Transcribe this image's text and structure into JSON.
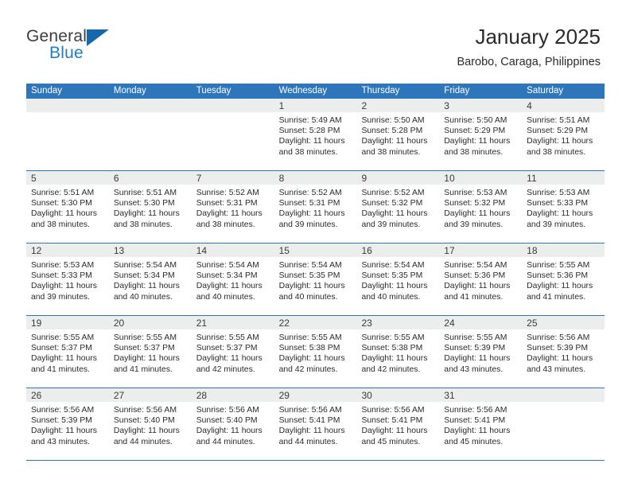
{
  "brand": {
    "name_part1": "General",
    "name_part2": "Blue",
    "accent_color": "#1668ad",
    "logo_icon": "triangle-flag-icon"
  },
  "header": {
    "title": "January 2025",
    "location": "Barobo, Caraga, Philippines"
  },
  "calendar": {
    "header_color": "#2e76bc",
    "daynum_band_color": "#eceded",
    "weekday_headers": [
      "Sunday",
      "Monday",
      "Tuesday",
      "Wednesday",
      "Thursday",
      "Friday",
      "Saturday"
    ],
    "weeks": [
      [
        {
          "day": "",
          "empty": true,
          "lines": []
        },
        {
          "day": "",
          "empty": true,
          "lines": []
        },
        {
          "day": "",
          "empty": true,
          "lines": []
        },
        {
          "day": "1",
          "empty": false,
          "lines": [
            "Sunrise: 5:49 AM",
            "Sunset: 5:28 PM",
            "Daylight: 11 hours",
            "and 38 minutes."
          ]
        },
        {
          "day": "2",
          "empty": false,
          "lines": [
            "Sunrise: 5:50 AM",
            "Sunset: 5:28 PM",
            "Daylight: 11 hours",
            "and 38 minutes."
          ]
        },
        {
          "day": "3",
          "empty": false,
          "lines": [
            "Sunrise: 5:50 AM",
            "Sunset: 5:29 PM",
            "Daylight: 11 hours",
            "and 38 minutes."
          ]
        },
        {
          "day": "4",
          "empty": false,
          "lines": [
            "Sunrise: 5:51 AM",
            "Sunset: 5:29 PM",
            "Daylight: 11 hours",
            "and 38 minutes."
          ]
        }
      ],
      [
        {
          "day": "5",
          "empty": false,
          "lines": [
            "Sunrise: 5:51 AM",
            "Sunset: 5:30 PM",
            "Daylight: 11 hours",
            "and 38 minutes."
          ]
        },
        {
          "day": "6",
          "empty": false,
          "lines": [
            "Sunrise: 5:51 AM",
            "Sunset: 5:30 PM",
            "Daylight: 11 hours",
            "and 38 minutes."
          ]
        },
        {
          "day": "7",
          "empty": false,
          "lines": [
            "Sunrise: 5:52 AM",
            "Sunset: 5:31 PM",
            "Daylight: 11 hours",
            "and 38 minutes."
          ]
        },
        {
          "day": "8",
          "empty": false,
          "lines": [
            "Sunrise: 5:52 AM",
            "Sunset: 5:31 PM",
            "Daylight: 11 hours",
            "and 39 minutes."
          ]
        },
        {
          "day": "9",
          "empty": false,
          "lines": [
            "Sunrise: 5:52 AM",
            "Sunset: 5:32 PM",
            "Daylight: 11 hours",
            "and 39 minutes."
          ]
        },
        {
          "day": "10",
          "empty": false,
          "lines": [
            "Sunrise: 5:53 AM",
            "Sunset: 5:32 PM",
            "Daylight: 11 hours",
            "and 39 minutes."
          ]
        },
        {
          "day": "11",
          "empty": false,
          "lines": [
            "Sunrise: 5:53 AM",
            "Sunset: 5:33 PM",
            "Daylight: 11 hours",
            "and 39 minutes."
          ]
        }
      ],
      [
        {
          "day": "12",
          "empty": false,
          "lines": [
            "Sunrise: 5:53 AM",
            "Sunset: 5:33 PM",
            "Daylight: 11 hours",
            "and 39 minutes."
          ]
        },
        {
          "day": "13",
          "empty": false,
          "lines": [
            "Sunrise: 5:54 AM",
            "Sunset: 5:34 PM",
            "Daylight: 11 hours",
            "and 40 minutes."
          ]
        },
        {
          "day": "14",
          "empty": false,
          "lines": [
            "Sunrise: 5:54 AM",
            "Sunset: 5:34 PM",
            "Daylight: 11 hours",
            "and 40 minutes."
          ]
        },
        {
          "day": "15",
          "empty": false,
          "lines": [
            "Sunrise: 5:54 AM",
            "Sunset: 5:35 PM",
            "Daylight: 11 hours",
            "and 40 minutes."
          ]
        },
        {
          "day": "16",
          "empty": false,
          "lines": [
            "Sunrise: 5:54 AM",
            "Sunset: 5:35 PM",
            "Daylight: 11 hours",
            "and 40 minutes."
          ]
        },
        {
          "day": "17",
          "empty": false,
          "lines": [
            "Sunrise: 5:54 AM",
            "Sunset: 5:36 PM",
            "Daylight: 11 hours",
            "and 41 minutes."
          ]
        },
        {
          "day": "18",
          "empty": false,
          "lines": [
            "Sunrise: 5:55 AM",
            "Sunset: 5:36 PM",
            "Daylight: 11 hours",
            "and 41 minutes."
          ]
        }
      ],
      [
        {
          "day": "19",
          "empty": false,
          "lines": [
            "Sunrise: 5:55 AM",
            "Sunset: 5:37 PM",
            "Daylight: 11 hours",
            "and 41 minutes."
          ]
        },
        {
          "day": "20",
          "empty": false,
          "lines": [
            "Sunrise: 5:55 AM",
            "Sunset: 5:37 PM",
            "Daylight: 11 hours",
            "and 41 minutes."
          ]
        },
        {
          "day": "21",
          "empty": false,
          "lines": [
            "Sunrise: 5:55 AM",
            "Sunset: 5:37 PM",
            "Daylight: 11 hours",
            "and 42 minutes."
          ]
        },
        {
          "day": "22",
          "empty": false,
          "lines": [
            "Sunrise: 5:55 AM",
            "Sunset: 5:38 PM",
            "Daylight: 11 hours",
            "and 42 minutes."
          ]
        },
        {
          "day": "23",
          "empty": false,
          "lines": [
            "Sunrise: 5:55 AM",
            "Sunset: 5:38 PM",
            "Daylight: 11 hours",
            "and 42 minutes."
          ]
        },
        {
          "day": "24",
          "empty": false,
          "lines": [
            "Sunrise: 5:55 AM",
            "Sunset: 5:39 PM",
            "Daylight: 11 hours",
            "and 43 minutes."
          ]
        },
        {
          "day": "25",
          "empty": false,
          "lines": [
            "Sunrise: 5:56 AM",
            "Sunset: 5:39 PM",
            "Daylight: 11 hours",
            "and 43 minutes."
          ]
        }
      ],
      [
        {
          "day": "26",
          "empty": false,
          "lines": [
            "Sunrise: 5:56 AM",
            "Sunset: 5:39 PM",
            "Daylight: 11 hours",
            "and 43 minutes."
          ]
        },
        {
          "day": "27",
          "empty": false,
          "lines": [
            "Sunrise: 5:56 AM",
            "Sunset: 5:40 PM",
            "Daylight: 11 hours",
            "and 44 minutes."
          ]
        },
        {
          "day": "28",
          "empty": false,
          "lines": [
            "Sunrise: 5:56 AM",
            "Sunset: 5:40 PM",
            "Daylight: 11 hours",
            "and 44 minutes."
          ]
        },
        {
          "day": "29",
          "empty": false,
          "lines": [
            "Sunrise: 5:56 AM",
            "Sunset: 5:41 PM",
            "Daylight: 11 hours",
            "and 44 minutes."
          ]
        },
        {
          "day": "30",
          "empty": false,
          "lines": [
            "Sunrise: 5:56 AM",
            "Sunset: 5:41 PM",
            "Daylight: 11 hours",
            "and 45 minutes."
          ]
        },
        {
          "day": "31",
          "empty": false,
          "lines": [
            "Sunrise: 5:56 AM",
            "Sunset: 5:41 PM",
            "Daylight: 11 hours",
            "and 45 minutes."
          ]
        },
        {
          "day": "",
          "empty": true,
          "lines": []
        }
      ]
    ]
  }
}
